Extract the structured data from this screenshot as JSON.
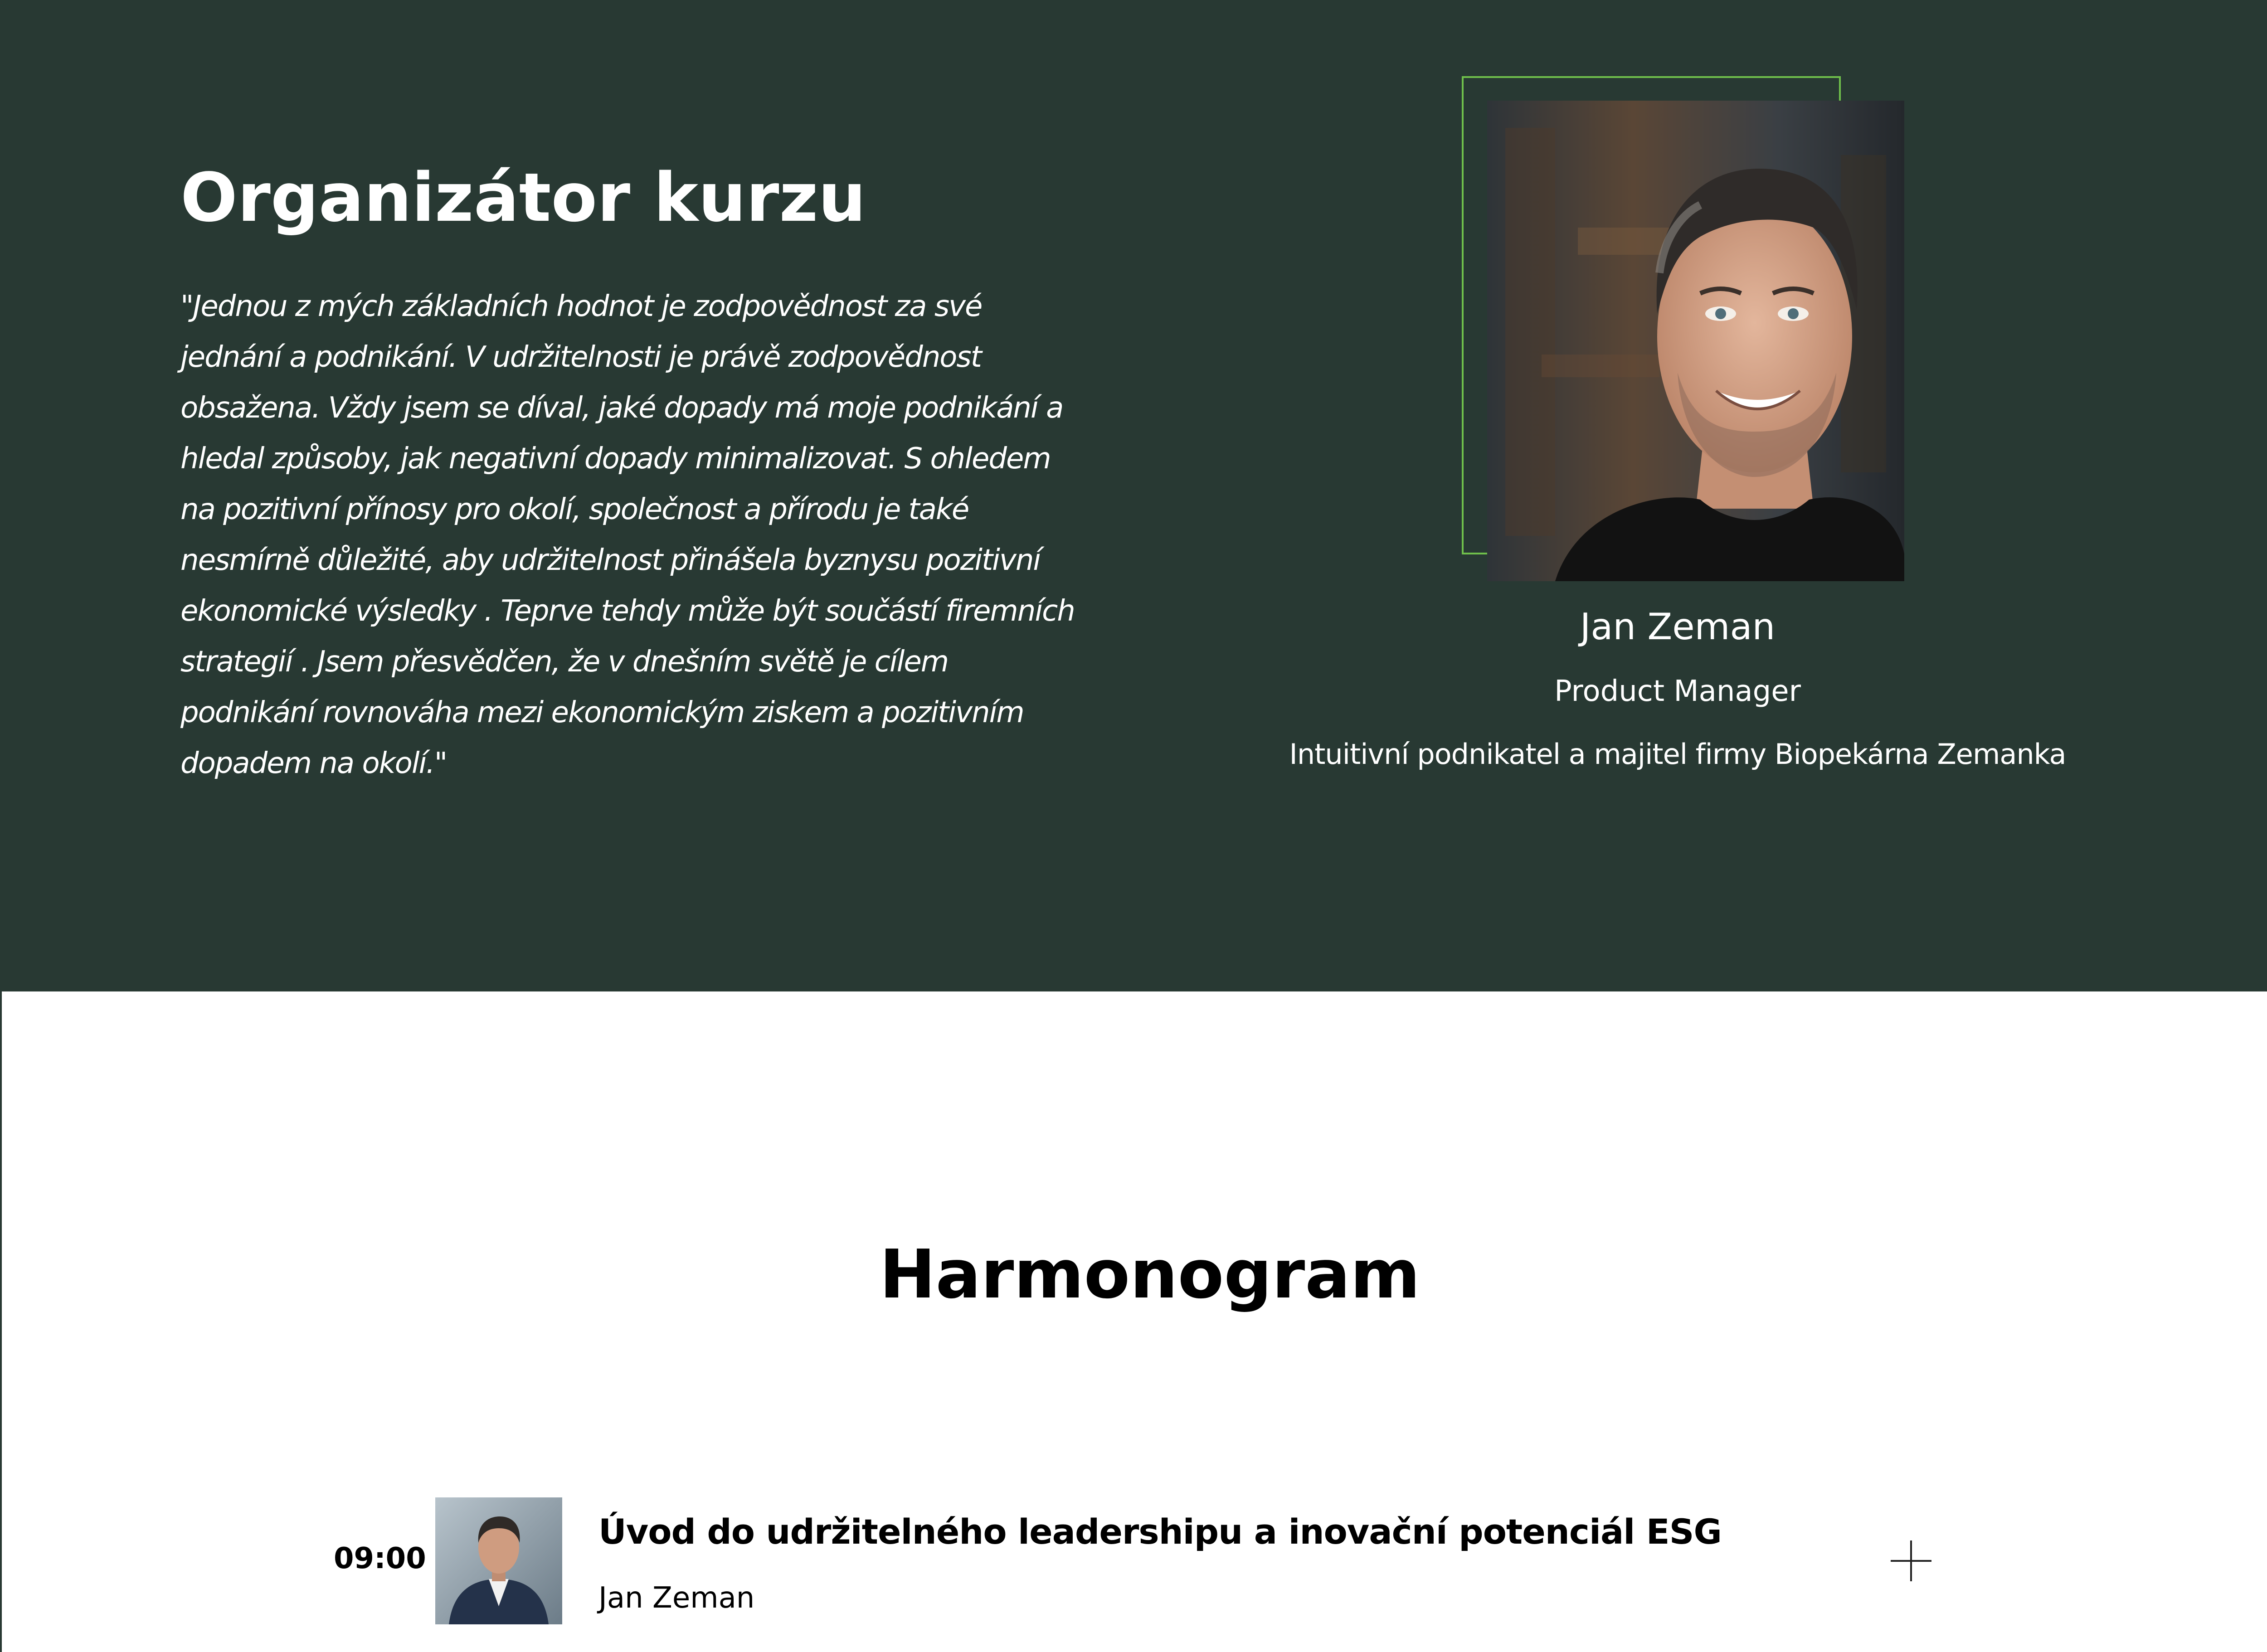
{
  "organizer": {
    "title": "Organizátor kurzu",
    "quote": "\"Jednou z mých základních hodnot je zodpovědnost za své jednání a podnikání. V udržitelnosti je právě zodpovědnost obsažena. Vždy jsem se díval, jaké dopady má moje podnikání a hledal způsoby, jak negativní dopady minimalizovat. S ohledem na pozitivní přínosy pro okolí, společnost a přírodu je také nesmírně důležité, aby udržitelnost přinášela byznysu pozitivní ekonomické výsledky . Teprve tehdy může být součástí firemních strategií . Jsem přesvědčen, že v dnešním světě je cílem podnikání rovnováha mezi ekonomickým ziskem a pozitivním dopadem na okolí.\"",
    "person": {
      "name": "Jan Zeman",
      "role": "Product Manager",
      "description": "Intuitivní podnikatel a majitel firmy Biopekárna Zemanka"
    }
  },
  "harmonogram": {
    "title": "Harmonogram",
    "items": [
      {
        "time": "09:00",
        "title": "Úvod do udržitelného leadershipu a inovační potenciál ESG",
        "speaker": "Jan Zeman"
      }
    ]
  },
  "colors": {
    "section_bg": "#283933",
    "frame_accent": "#6fbf4b",
    "text_light": "#ffffff",
    "text_dark": "#000000"
  }
}
